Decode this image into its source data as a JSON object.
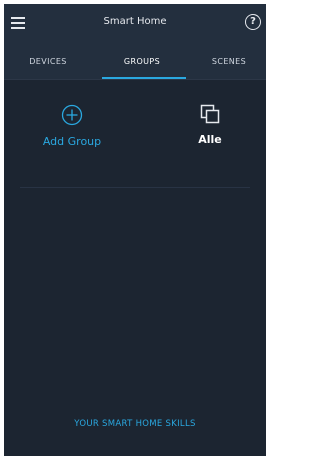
{
  "header": {
    "title": "Smart Home"
  },
  "tabs": [
    {
      "label": "DEVICES",
      "active": false
    },
    {
      "label": "GROUPS",
      "active": true
    },
    {
      "label": "SCENES",
      "active": false
    }
  ],
  "groups": {
    "add_label": "Add Group",
    "items": [
      {
        "label": "Alle"
      }
    ]
  },
  "footer": {
    "skills_link": "YOUR SMART HOME SKILLS"
  },
  "colors": {
    "accent": "#2aa8e0",
    "background": "#1c2531",
    "topbar": "#232f3e"
  },
  "icons": {
    "menu": "hamburger-menu-icon",
    "help": "help-circle-icon",
    "add": "plus-circle-icon",
    "group": "group-stack-icon"
  }
}
